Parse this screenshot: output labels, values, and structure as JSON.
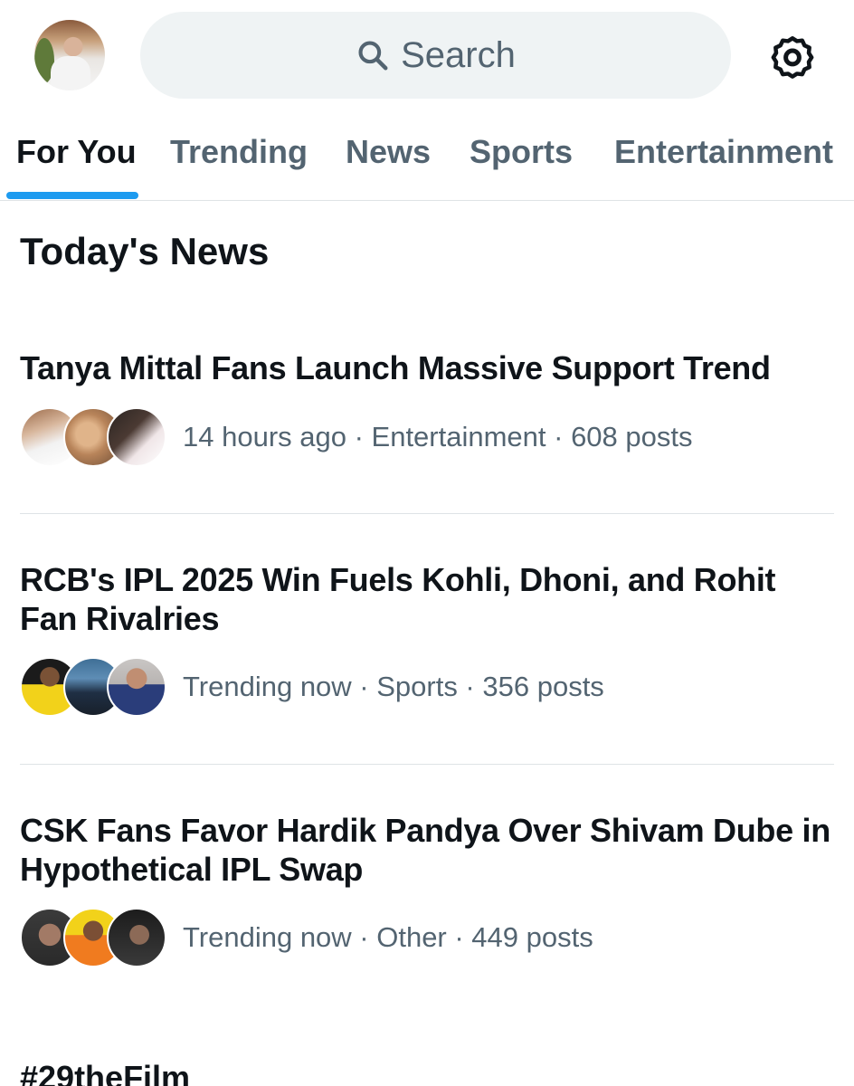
{
  "search": {
    "placeholder": "Search",
    "icon": "search-icon"
  },
  "settings": {
    "icon": "gear-icon"
  },
  "tabs": [
    {
      "label": "For You",
      "active": true
    },
    {
      "label": "Trending",
      "active": false
    },
    {
      "label": "News",
      "active": false
    },
    {
      "label": "Sports",
      "active": false
    },
    {
      "label": "Entertainment",
      "active": false
    }
  ],
  "section": {
    "title": "Today's News"
  },
  "stories": [
    {
      "title": "Tanya Mittal Fans Launch Massive Support Trend",
      "meta": "14 hours ago · Entertainment · 608 posts"
    },
    {
      "title": "RCB's IPL 2025 Win Fuels Kohli, Dhoni, and Rohit Fan Rivalries",
      "meta": "Trending now · Sports · 356 posts"
    },
    {
      "title": "CSK Fans Favor Hardik Pandya Over Shivam Dube in Hypothetical IPL Swap",
      "meta": "Trending now · Other · 449 posts"
    }
  ],
  "next_story": {
    "title": "#29theFilm"
  },
  "colors": {
    "accent": "#1d9bf0",
    "muted": "#536471",
    "text": "#0f1419",
    "search_bg": "#eff3f4"
  }
}
